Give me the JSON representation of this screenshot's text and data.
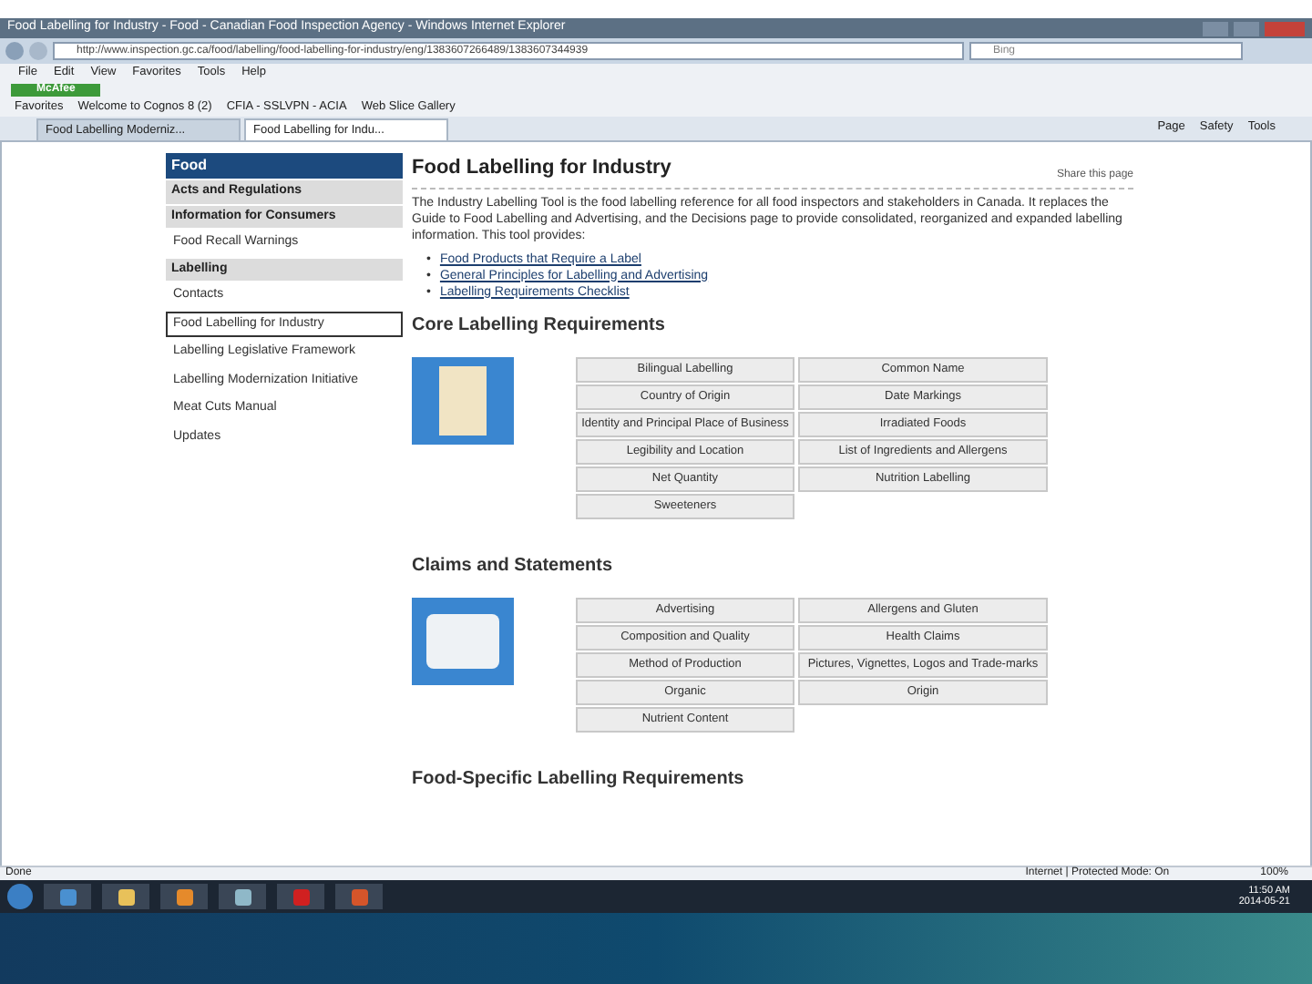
{
  "window": {
    "title": "Food Labelling for Industry - Food - Canadian Food Inspection Agency - Windows Internet Explorer"
  },
  "address_bar": {
    "url": "http://www.inspection.gc.ca/food/labelling/food-labelling-for-industry/eng/1383607266489/1383607344939"
  },
  "search": {
    "placeholder": "Bing"
  },
  "menu": [
    "File",
    "Edit",
    "View",
    "Favorites",
    "Tools",
    "Help"
  ],
  "mcafee": {
    "label": "McAfee"
  },
  "favorites_bar": {
    "label": "Favorites",
    "items": [
      "Welcome to Cognos 8 (2)",
      "CFIA - SSLVPN - ACIA",
      "Web Slice Gallery"
    ]
  },
  "tabs": [
    {
      "label": "Food Labelling Moderniz...",
      "selected": false
    },
    {
      "label": "Food Labelling for Indu...",
      "selected": true
    }
  ],
  "command_bar": [
    "Page",
    "Safety",
    "Tools"
  ],
  "sidebar": {
    "items": [
      {
        "label": "Food",
        "kind": "top"
      },
      {
        "label": "Acts and Regulations",
        "kind": "section"
      },
      {
        "label": "Information for Consumers",
        "kind": "section"
      },
      {
        "label": "Food Recall Warnings",
        "kind": "link",
        "selected": false
      },
      {
        "label": "Labelling",
        "kind": "section"
      },
      {
        "label": "Contacts",
        "kind": "link",
        "selected": false
      },
      {
        "label": "Food Labelling for Industry",
        "kind": "link",
        "selected": true
      },
      {
        "label": "Labelling Legislative Framework",
        "kind": "link",
        "selected": false
      },
      {
        "label": "Labelling Modernization Initiative",
        "kind": "link",
        "selected": false
      },
      {
        "label": "Meat Cuts Manual",
        "kind": "link",
        "selected": false
      },
      {
        "label": "Updates",
        "kind": "link",
        "selected": false
      }
    ]
  },
  "content": {
    "title": "Food Labelling for Industry",
    "share": "Share this page",
    "intro": "The Industry Labelling Tool is the food labelling reference for all food inspectors and stakeholders in Canada. It replaces the Guide to Food Labelling and Advertising, and the Decisions page to provide consolidated, reorganized and expanded labelling information. This tool provides:",
    "links": [
      {
        "bullet": "•",
        "label": "Food Products that Require a Label"
      },
      {
        "bullet": "•",
        "label": "General Principles for Labelling and Advertising"
      },
      {
        "bullet": "•",
        "label": "Labelling Requirements Checklist"
      }
    ],
    "sections": [
      {
        "heading": "Core Labelling Requirements",
        "rows": [
          [
            "Bilingual Labelling",
            "Common Name"
          ],
          [
            "Country of Origin",
            "Date Markings"
          ],
          [
            "Identity and Principal Place of Business",
            "Irradiated Foods"
          ],
          [
            "Legibility and Location",
            "List of Ingredients and Allergens"
          ],
          [
            "Net Quantity",
            "Nutrition Labelling"
          ],
          [
            "Sweeteners"
          ]
        ]
      },
      {
        "heading": "Claims and Statements",
        "rows": [
          [
            "Advertising",
            "Allergens and Gluten"
          ],
          [
            "Composition and Quality",
            "Health Claims"
          ],
          [
            "Method of Production",
            "Pictures, Vignettes, Logos and Trade-marks"
          ],
          [
            "Organic",
            "Origin"
          ],
          [
            "Nutrient Content"
          ]
        ]
      },
      {
        "heading": "Food-Specific Labelling Requirements"
      }
    ]
  },
  "status_bar": {
    "left": "Done",
    "zone": "Internet | Protected Mode: On",
    "zoom": "100%"
  },
  "taskbar": {
    "time": "11:50 AM",
    "date": "2014-05-21"
  }
}
